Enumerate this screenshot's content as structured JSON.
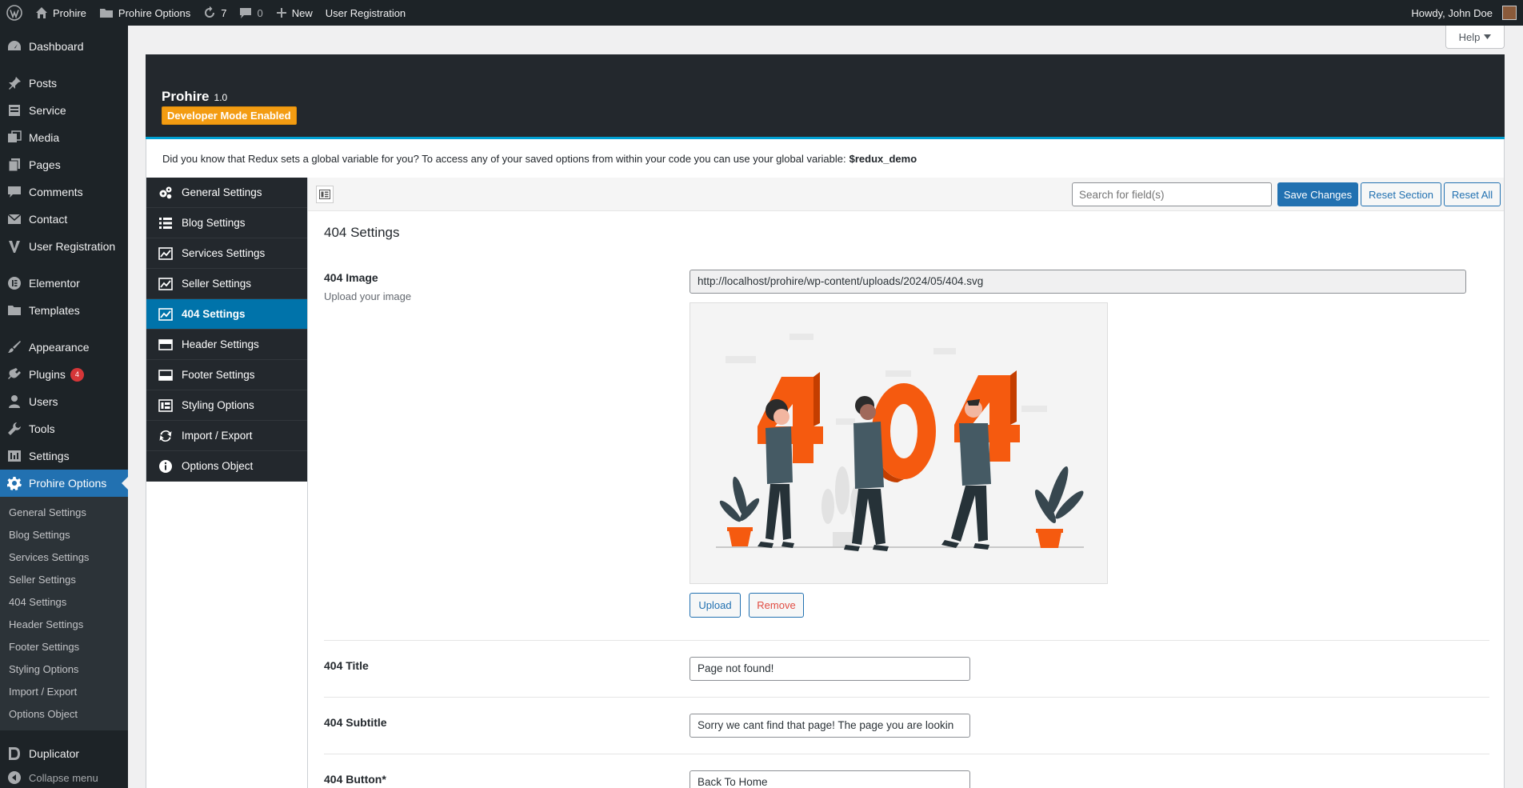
{
  "adminbar": {
    "site_name": "Prohire",
    "options_name": "Prohire Options",
    "updates_count": "7",
    "comments_count": "0",
    "new_label": "New",
    "user_registration": "User Registration",
    "howdy": "Howdy, John Doe"
  },
  "adminmenu": {
    "items": [
      {
        "label": "Dashboard",
        "icon": "dashboard-icon"
      },
      {
        "label": "Posts",
        "icon": "pin-icon"
      },
      {
        "label": "Service",
        "icon": "service-icon"
      },
      {
        "label": "Media",
        "icon": "media-icon"
      },
      {
        "label": "Pages",
        "icon": "pages-icon"
      },
      {
        "label": "Comments",
        "icon": "comments-icon"
      },
      {
        "label": "Contact",
        "icon": "mail-icon"
      },
      {
        "label": "User Registration",
        "icon": "user-registration-icon"
      },
      {
        "label": "Elementor",
        "icon": "elementor-icon"
      },
      {
        "label": "Templates",
        "icon": "folder-icon"
      },
      {
        "label": "Appearance",
        "icon": "brush-icon"
      },
      {
        "label": "Plugins",
        "icon": "plugin-icon",
        "badge": "4"
      },
      {
        "label": "Users",
        "icon": "users-icon"
      },
      {
        "label": "Tools",
        "icon": "wrench-icon"
      },
      {
        "label": "Settings",
        "icon": "settings-icon"
      },
      {
        "label": "Prohire Options",
        "icon": "gear-icon"
      },
      {
        "label": "Duplicator",
        "icon": "duplicator-icon"
      },
      {
        "label": "Collapse menu",
        "icon": "collapse-icon"
      }
    ],
    "submenu": [
      "General Settings",
      "Blog Settings",
      "Services Settings",
      "Seller Settings",
      "404 Settings",
      "Header Settings",
      "Footer Settings",
      "Styling Options",
      "Import / Export",
      "Options Object"
    ]
  },
  "help_label": "Help",
  "redux": {
    "title": "Prohire",
    "version": "1.0",
    "dev_mode": "Developer Mode Enabled",
    "notice_text": "Did you know that Redux sets a global variable for you? To access any of your saved options from within your code you can use your global variable:",
    "notice_var": "$redux_demo",
    "menu": [
      {
        "label": "General Settings",
        "icon": "cogs-icon"
      },
      {
        "label": "Blog Settings",
        "icon": "list-icon"
      },
      {
        "label": "Services Settings",
        "icon": "chart-icon"
      },
      {
        "label": "Seller Settings",
        "icon": "chart-icon"
      },
      {
        "label": "404 Settings",
        "icon": "chart-icon"
      },
      {
        "label": "Header Settings",
        "icon": "header-icon"
      },
      {
        "label": "Footer Settings",
        "icon": "footer-icon"
      },
      {
        "label": "Styling Options",
        "icon": "styling-icon"
      },
      {
        "label": "Import / Export",
        "icon": "refresh-icon"
      },
      {
        "label": "Options Object",
        "icon": "info-icon"
      }
    ],
    "search_placeholder": "Search for field(s)",
    "save_label": "Save Changes",
    "reset_section_label": "Reset Section",
    "reset_all_label": "Reset All"
  },
  "section": {
    "title": "404 Settings",
    "image_label": "404 Image",
    "image_desc": "Upload your image",
    "image_url": "http://localhost/prohire/wp-content/uploads/2024/05/404.svg",
    "upload_label": "Upload",
    "remove_label": "Remove",
    "title_label": "404 Title",
    "title_value": "Page not found!",
    "subtitle_label": "404 Subtitle",
    "subtitle_value": "Sorry we cant find that page! The page you are lookin",
    "button_label": "404 Button*",
    "button_value": "Back To Home"
  },
  "colors": {
    "admin_dark": "#1d2327",
    "accent_blue": "#2271b1",
    "redux_active": "#0073aa",
    "dev_badge": "#f39c12",
    "illustration_orange": "#f55a0f"
  }
}
